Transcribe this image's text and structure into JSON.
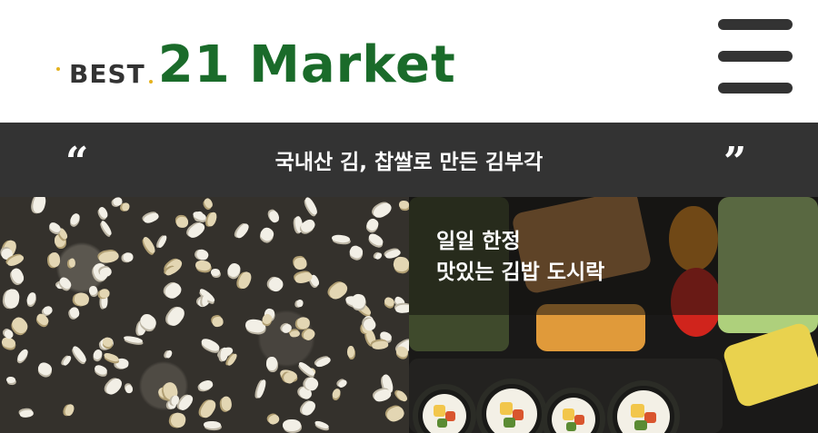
{
  "header": {
    "logo": {
      "prefix": "BEST",
      "name": "21 Market"
    },
    "menu_icon": "hamburger-menu-icon"
  },
  "banner": {
    "open_quote": "“",
    "text": "국내산 김, 찹쌀로 만든 김부각",
    "close_quote": "”"
  },
  "tiles": {
    "left": {
      "image": "seaweed-chips-closeup"
    },
    "right": {
      "image": "kimbap-lunchbox",
      "caption_line1": "일일 한정",
      "caption_line2": "맛있는 김밥 도시락"
    }
  },
  "colors": {
    "brand_green": "#1a6b2a",
    "banner_bg": "#333333",
    "logo_dots": "#e5b21d"
  }
}
